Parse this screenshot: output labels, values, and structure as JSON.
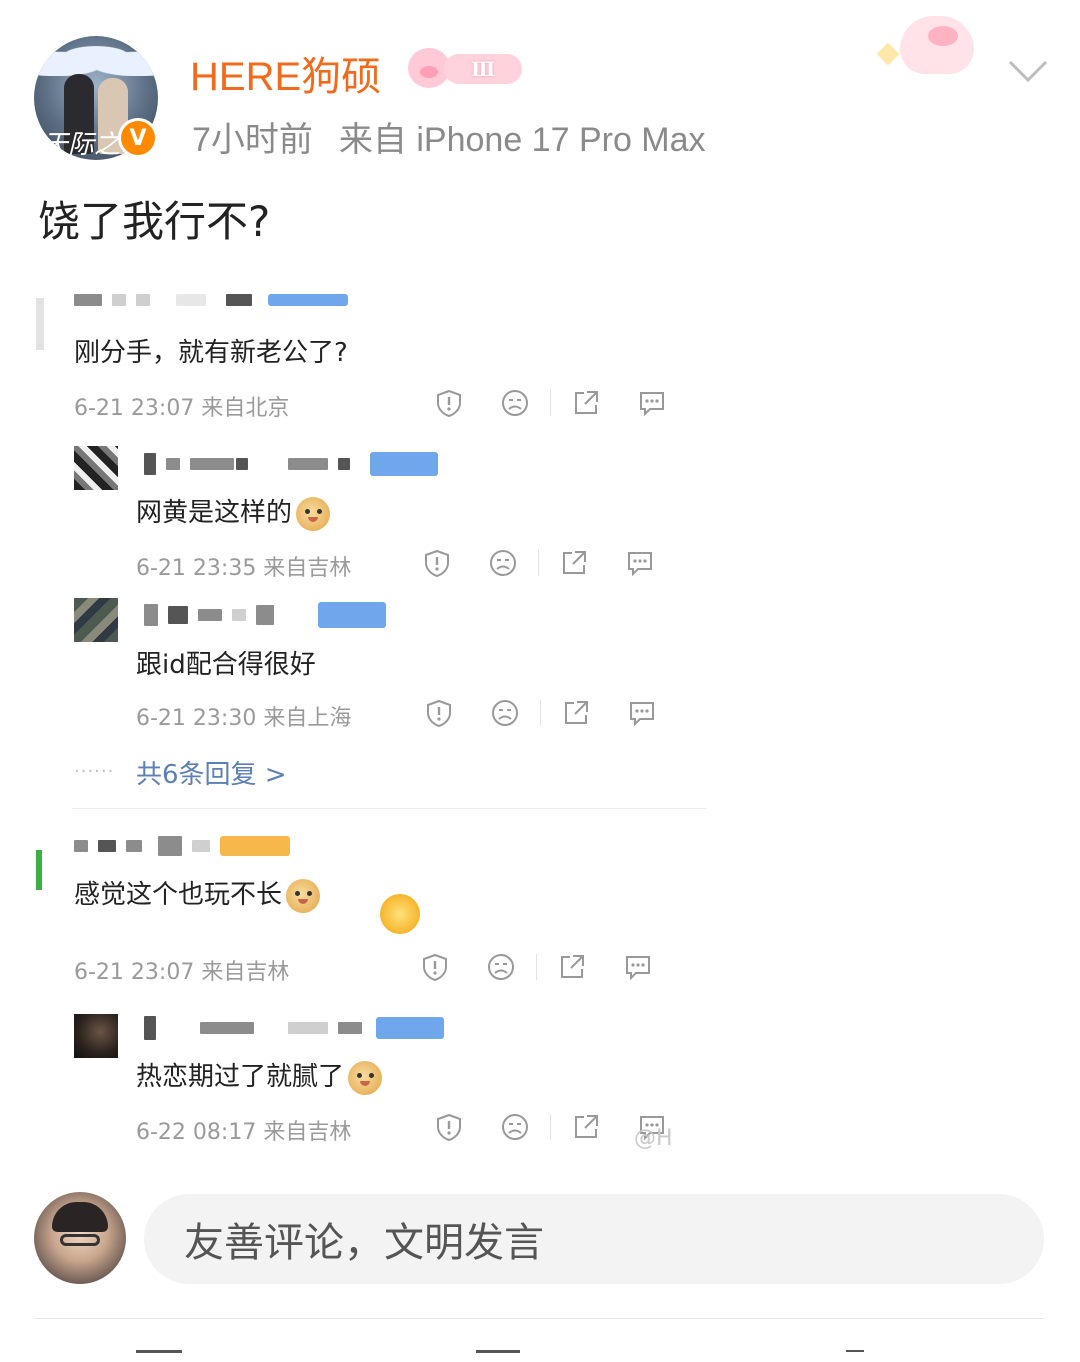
{
  "post": {
    "username": "HERE狗硕",
    "level_badge": "Ⅲ",
    "verified_mark": "V",
    "avatar_signature": "天际之夜",
    "time": "7小时前",
    "source": "来自 iPhone 17 Pro Max",
    "text": "饶了我行不?"
  },
  "screenshot_comments": [
    {
      "text": "刚分手，就有新老公了?",
      "meta": "6-21 23:07 来自北京",
      "replies": [
        {
          "text": "网黄是这样的",
          "meta": "6-21 23:35 来自吉林",
          "emoji": "doge"
        },
        {
          "text": "跟id配合得很好",
          "meta": "6-21 23:30 来自上海"
        }
      ],
      "more_replies": "共6条回复 >"
    },
    {
      "text": "感觉这个也玩不长",
      "meta": "6-21 23:07 来自吉林",
      "emoji": "doge",
      "replies": [
        {
          "text": "热恋期过了就腻了",
          "meta": "6-22 08:17 来自吉林",
          "emoji": "doge"
        }
      ]
    }
  ],
  "watermark": "@H",
  "comment_box": {
    "placeholder": "友善评论，文明发言"
  },
  "icons": [
    "report-icon",
    "dislike-icon",
    "share-icon",
    "comment-icon",
    "chevron-down-icon",
    "verified-icon"
  ],
  "colors": {
    "username": "#f26b1d",
    "meta": "#8a8a8a",
    "link": "#5c7fb5",
    "verified": "#ff8a00"
  }
}
